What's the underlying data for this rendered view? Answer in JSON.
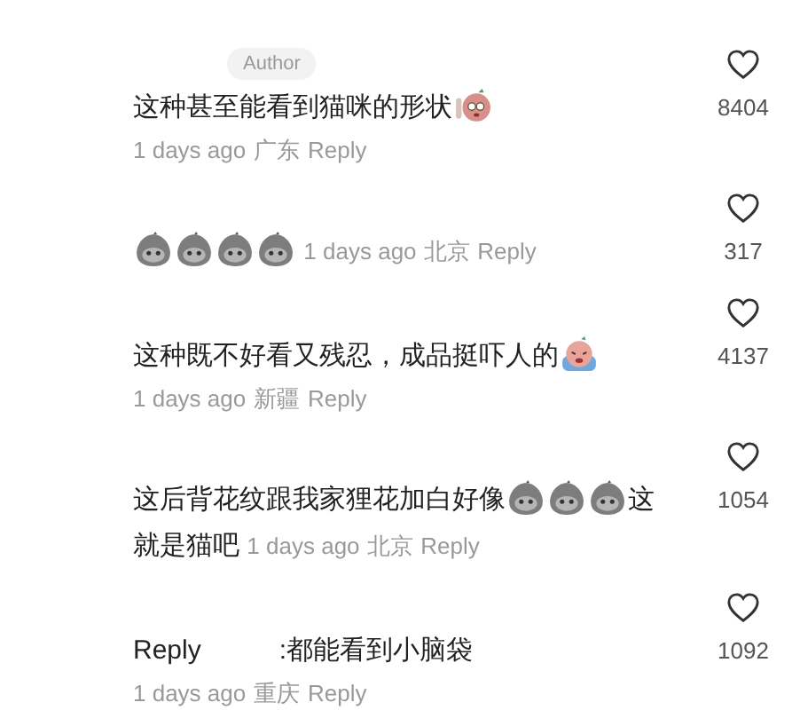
{
  "comments": [
    {
      "badge": "Author",
      "segments": [
        {
          "kind": "text",
          "text": "这种甚至能看到猫咪的形状"
        },
        {
          "kind": "face"
        }
      ],
      "meta_inline": false,
      "time": "1 days ago",
      "location": "广东",
      "reply": "Reply",
      "likes": "8404"
    },
    {
      "segments": [
        {
          "kind": "blob"
        },
        {
          "kind": "blob"
        },
        {
          "kind": "blob"
        },
        {
          "kind": "blob"
        }
      ],
      "meta_inline": true,
      "time": "1 days ago",
      "location": "北京",
      "reply": "Reply",
      "likes": "317"
    },
    {
      "segments": [
        {
          "kind": "text",
          "text": "这种既不好看又残忍，成品挺吓人的"
        },
        {
          "kind": "crying-face"
        }
      ],
      "meta_inline": false,
      "time": "1 days ago",
      "location": "新疆",
      "reply": "Reply",
      "likes": "4137"
    },
    {
      "segments": [
        {
          "kind": "text",
          "text": "这后背花纹跟我家狸花加白好像"
        },
        {
          "kind": "blob"
        },
        {
          "kind": "blob"
        },
        {
          "kind": "blob"
        },
        {
          "kind": "text",
          "text": "这"
        },
        {
          "kind": "text",
          "text": "就是猫吧"
        }
      ],
      "meta_inline": true,
      "time": "1 days ago",
      "location": "北京",
      "reply": "Reply",
      "likes": "1054"
    },
    {
      "segments": [
        {
          "kind": "text",
          "text": "Reply"
        },
        {
          "kind": "text",
          "text": ":都能看到小脑袋",
          "gap": true
        }
      ],
      "meta_inline": false,
      "time": "1 days ago",
      "location": "重庆",
      "reply": "Reply",
      "likes": "1092"
    }
  ]
}
